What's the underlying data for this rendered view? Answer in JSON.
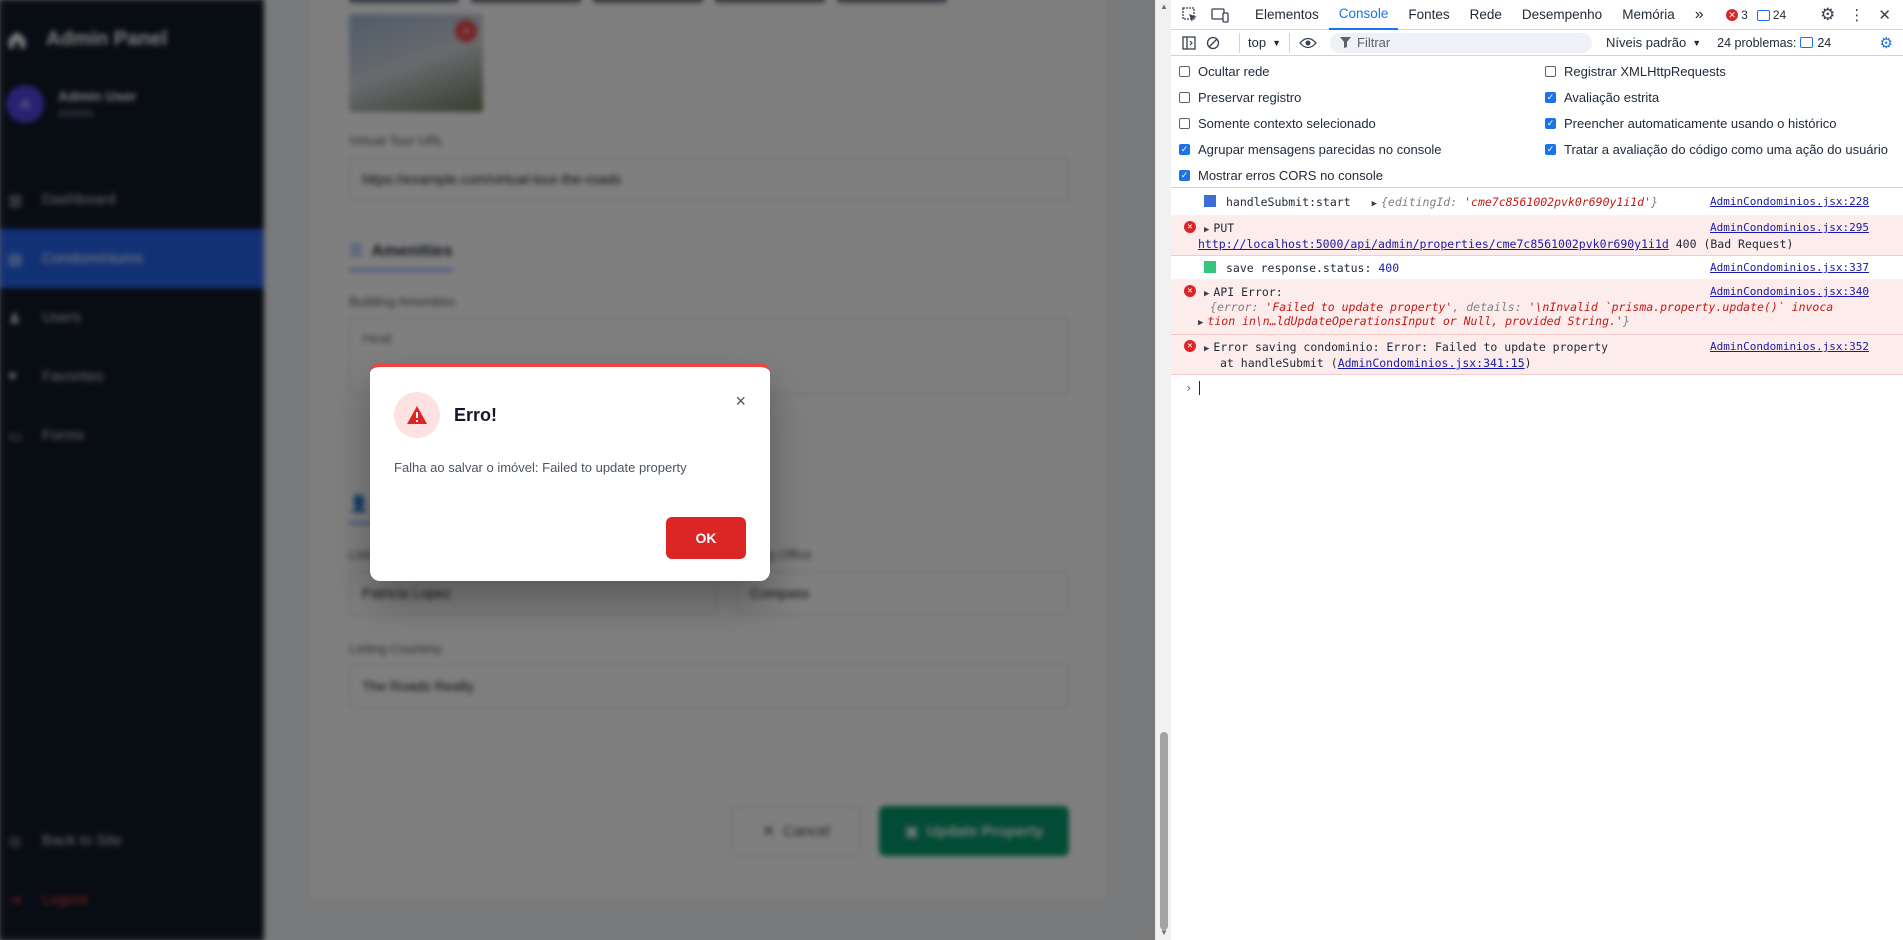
{
  "app": {
    "brand": "Admin Panel",
    "user": {
      "name": "Admin User",
      "role": "ADMIN",
      "initial": "A"
    },
    "nav": [
      {
        "label": "Dashboard"
      },
      {
        "label": "Condomíniums"
      },
      {
        "label": "Users"
      },
      {
        "label": "Favorites"
      },
      {
        "label": "Forms"
      }
    ],
    "nav_bottom": [
      {
        "label": "Back to Site"
      },
      {
        "label": "Logout"
      }
    ],
    "form": {
      "virtual_tour_label": "Virtual Tour URL",
      "virtual_tour_value": "https://example.com/virtual-tour-the-roads",
      "amenities_title": "Amenities",
      "building_amenities_label": "Building Amenities",
      "building_amenities_value": "Heat",
      "listing_title": "Li",
      "listing_agent_label": "Listing Agent",
      "listing_agent_value": "Patricia Lopez",
      "listing_office_label": "Listing Office",
      "listing_office_value": "Compass",
      "listing_courtesy_label": "Listing Courtesy",
      "listing_courtesy_value": "The Roads Realty",
      "cancel_label": "Cancel",
      "update_label": "Update Property"
    }
  },
  "modal": {
    "title": "Erro!",
    "message": "Falha ao salvar o imóvel: Failed to update property",
    "ok_label": "OK",
    "close_symbol": "×"
  },
  "devtools": {
    "tabs": [
      "Elementos",
      "Console",
      "Fontes",
      "Rede",
      "Desempenho",
      "Memória"
    ],
    "more_tabs": "»",
    "error_count": "3",
    "message_count": "24",
    "context": "top",
    "filter_placeholder": "Filtrar",
    "levels": "Níveis padrão",
    "problems_label": "24 problemas:",
    "problems_count": "24",
    "settings_left": [
      {
        "label": "Ocultar rede",
        "checked": false
      },
      {
        "label": "Preservar registro",
        "checked": false
      },
      {
        "label": "Somente contexto selecionado",
        "checked": false
      },
      {
        "label": "Agrupar mensagens parecidas no console",
        "checked": true
      },
      {
        "label": "Mostrar erros CORS no console",
        "checked": true
      }
    ],
    "settings_right": [
      {
        "label": "Registrar XMLHttpRequests",
        "checked": false
      },
      {
        "label": "Avaliação estrita",
        "checked": true
      },
      {
        "label": "Preencher automaticamente usando o histórico",
        "checked": true
      },
      {
        "label": "Tratar a avaliação do código como uma ação do usuário",
        "checked": true
      }
    ],
    "console": {
      "r1_text": "handleSubmit:start",
      "r1_key": "editingId",
      "r1_val": "'cme7c8561002pvk0r690y1i1d'",
      "r1_src": "AdminCondominios.jsx:228",
      "r2_text": "PUT",
      "r2_url": "http://localhost:5000/api/admin/properties/cme7c8561002pvk0r690y1i1d",
      "r2_status": "400 (Bad Request)",
      "r2_src": "AdminCondominios.jsx:295",
      "r3_text": "save response.status:",
      "r3_num": "400",
      "r3_src": "AdminCondominios.jsx:337",
      "r4_text": "API Error:",
      "r4_k1": "error",
      "r4_v1": "'Failed to update property'",
      "r4_k2": "details",
      "r4_v2a": "'\\nInvalid `prisma.property.update()` invoca",
      "r4_v2b": "tion in\\n…ldUpdateOperationsInput or Null, provided String.'",
      "r4_src": "AdminCondominios.jsx:340",
      "r5_text": "Error saving condominio: Error: Failed to update property",
      "r5_at": "at handleSubmit (",
      "r5_link": "AdminCondominios.jsx:341:15",
      "r5_end": ")",
      "r5_src": "AdminCondominios.jsx:352"
    }
  }
}
